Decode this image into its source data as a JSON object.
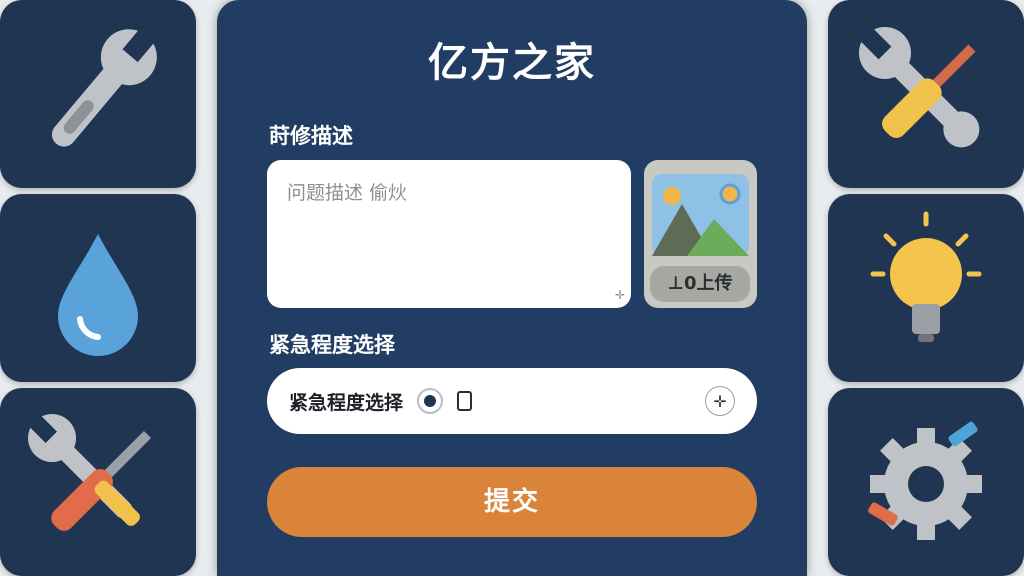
{
  "app": {
    "title": "亿方之家"
  },
  "form": {
    "description_label": "莳修描述",
    "description_placeholder": "问题描述 偷炏",
    "upload_label": "⊥0上传",
    "urgency_label": "紧急程度选择",
    "urgency_select_label": "紧急程度选择",
    "submit_label": "提交"
  },
  "icons": {
    "left": [
      "wrench-icon",
      "water-drop-icon",
      "screwdriver-wrench-icon"
    ],
    "right": [
      "wrench-screwdriver-icon",
      "lightbulb-icon",
      "gear-tools-icon"
    ]
  },
  "colors": {
    "panel": "#213d63",
    "tile": "#1f3552",
    "submit": "#d98438",
    "background": "#e9ecef"
  }
}
